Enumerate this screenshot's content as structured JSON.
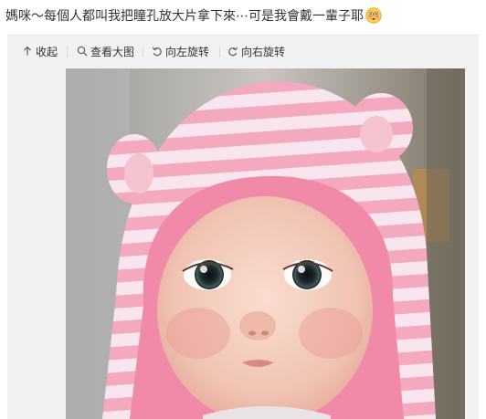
{
  "post": {
    "text": "媽咪～每個人都叫我把瞳孔放大片拿下來⋯可是我會戴一輩子耶",
    "emoji": "flushed-face-emoji"
  },
  "toolbar": {
    "collapse_label": "收起",
    "view_large_label": "查看大图",
    "rotate_left_label": "向左旋转",
    "rotate_right_label": "向右旋转"
  },
  "photo": {
    "subject": "baby-in-pink-striped-hood"
  },
  "colors": {
    "toolbar_bg": "#f2f2f2",
    "text": "#333333",
    "hood_pink": "#f6b3c5",
    "hood_white": "#f9e9ef"
  }
}
